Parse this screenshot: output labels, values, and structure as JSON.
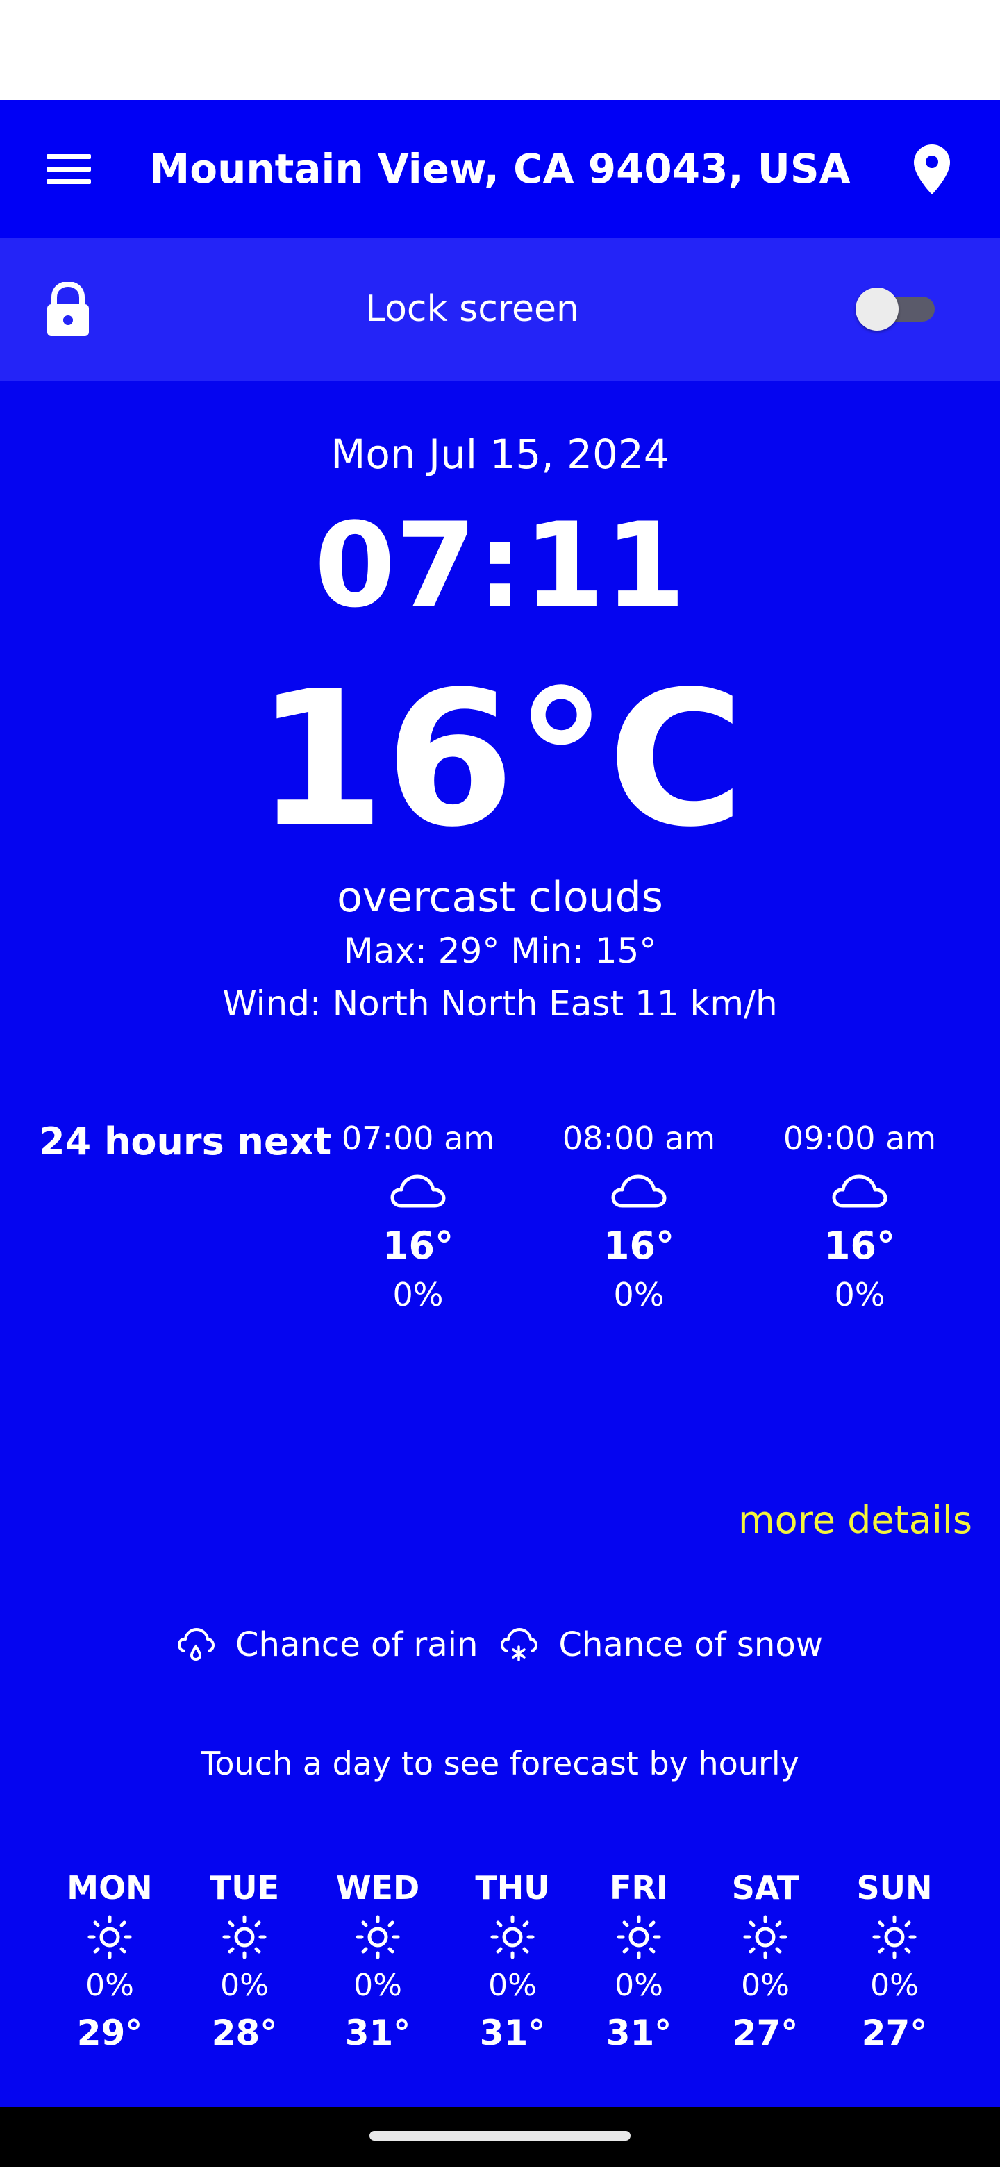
{
  "header": {
    "title": "Mountain View, CA 94043, USA",
    "menu_icon": "menu-icon",
    "location_icon": "location-pin-icon"
  },
  "lock": {
    "label": "Lock screen",
    "icon": "lock-icon",
    "enabled": false
  },
  "current": {
    "date": "Mon Jul 15, 2024",
    "time": "07:11",
    "temperature": "16°C",
    "description": "overcast clouds",
    "max_min": "Max: 29° Min: 15°",
    "wind": "Wind: North North East 11 km/h"
  },
  "hourly": {
    "label": "24 hours next",
    "items": [
      {
        "time": "07:00 am",
        "icon": "cloud-icon",
        "temp": "16°",
        "pop": "0%"
      },
      {
        "time": "08:00 am",
        "icon": "cloud-icon",
        "temp": "16°",
        "pop": "0%"
      },
      {
        "time": "09:00 am",
        "icon": "cloud-icon",
        "temp": "16°",
        "pop": "0%"
      }
    ]
  },
  "more_details": "more details",
  "legend": {
    "rain": "Chance of rain",
    "snow": "Chance of snow"
  },
  "touch_hint": "Touch a day to see forecast by hourly",
  "daily": [
    {
      "day": "MON",
      "icon": "sun-icon",
      "pop": "0%",
      "temp": "29°"
    },
    {
      "day": "TUE",
      "icon": "sun-icon",
      "pop": "0%",
      "temp": "28°"
    },
    {
      "day": "WED",
      "icon": "sun-icon",
      "pop": "0%",
      "temp": "31°"
    },
    {
      "day": "THU",
      "icon": "sun-icon",
      "pop": "0%",
      "temp": "31°"
    },
    {
      "day": "FRI",
      "icon": "sun-icon",
      "pop": "0%",
      "temp": "31°"
    },
    {
      "day": "SAT",
      "icon": "sun-icon",
      "pop": "0%",
      "temp": "27°"
    },
    {
      "day": "SUN",
      "icon": "sun-icon",
      "pop": "0%",
      "temp": "27°"
    }
  ],
  "colors": {
    "background": "#0505f0",
    "lock_row": "#2424f7",
    "link": "#f4f43c",
    "text": "#ffffff"
  }
}
